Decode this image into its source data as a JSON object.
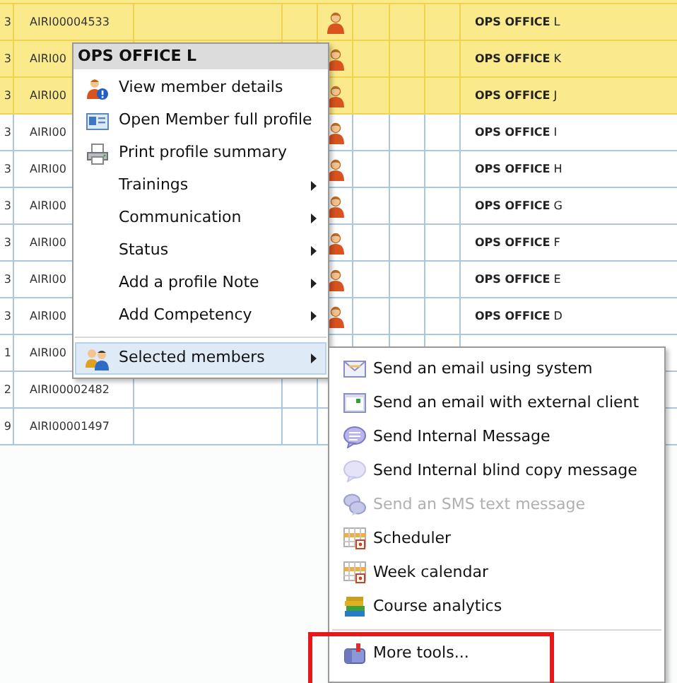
{
  "table": {
    "rows": [
      {
        "column_1": "3",
        "member_id": "AIRI00004533",
        "member_icon": true,
        "name": "**OPS OFFICE** L",
        "selected": true
      },
      {
        "column_1": "3",
        "member_id": "AIRI00",
        "member_icon": true,
        "name": "**OPS OFFICE** K",
        "selected": true
      },
      {
        "column_1": "3",
        "member_id": "AIRI00",
        "member_icon": true,
        "name": "**OPS OFFICE** J",
        "selected": true
      },
      {
        "column_1": "3",
        "member_id": "AIRI00",
        "member_icon": true,
        "name": "**OPS OFFICE** I",
        "selected": false
      },
      {
        "column_1": "3",
        "member_id": "AIRI00",
        "member_icon": true,
        "name": "**OPS OFFICE** H",
        "selected": false
      },
      {
        "column_1": "3",
        "member_id": "AIRI00",
        "member_icon": true,
        "name": "**OPS OFFICE** G",
        "selected": false
      },
      {
        "column_1": "3",
        "member_id": "AIRI00",
        "member_icon": true,
        "name": "**OPS OFFICE** F",
        "selected": false
      },
      {
        "column_1": "3",
        "member_id": "AIRI00",
        "member_icon": true,
        "name": "**OPS OFFICE** E",
        "selected": false
      },
      {
        "column_1": "3",
        "member_id": "AIRI00",
        "member_icon": true,
        "name": "**OPS OFFICE** D",
        "selected": false
      },
      {
        "column_1": "1",
        "member_id": "AIRI00",
        "member_icon": false,
        "selected": false
      },
      {
        "column_1": "2",
        "member_id": "AIRI00002482",
        "member_icon": false,
        "selected": false
      },
      {
        "column_1": "9",
        "member_id": "AIRI00001497",
        "member_icon": false,
        "selected": false
      }
    ]
  },
  "context_menu": {
    "title": "OPS OFFICE L",
    "items": [
      {
        "label": "View member details",
        "kind": "member-info",
        "has_submenu": false,
        "selected": false
      },
      {
        "label": "Open Member full profile",
        "kind": "profile-card",
        "has_submenu": false,
        "selected": false
      },
      {
        "label": "Print profile summary",
        "kind": "printer",
        "has_submenu": false,
        "selected": false
      },
      {
        "label": "Trainings",
        "has_submenu": true,
        "selected": false
      },
      {
        "label": "Communication",
        "has_submenu": true,
        "selected": false
      },
      {
        "label": "Status",
        "has_submenu": true,
        "selected": false
      },
      {
        "label": "Add a profile Note",
        "has_submenu": true,
        "selected": false
      },
      {
        "label": "Add Competency",
        "has_submenu": true,
        "selected": false
      },
      {
        "label": "Selected members",
        "kind": "people",
        "has_submenu": true,
        "selected": true,
        "separator_before": true
      }
    ]
  },
  "submenu": {
    "items": [
      {
        "label": "Send an email using system",
        "kind": "envelope",
        "disabled": false
      },
      {
        "label": "Send an email with external client",
        "kind": "window",
        "disabled": false
      },
      {
        "label": "Send Internal Message",
        "kind": "speech",
        "disabled": false
      },
      {
        "label": "Send Internal blind copy message",
        "kind": "speech-light",
        "disabled": false
      },
      {
        "label": "Send an SMS text message",
        "kind": "speech-double",
        "disabled": true
      },
      {
        "label": "Scheduler",
        "kind": "calendar",
        "disabled": false
      },
      {
        "label": "Week calendar",
        "kind": "calendar",
        "disabled": false
      },
      {
        "label": "Course analytics",
        "kind": "books",
        "disabled": false
      },
      {
        "label": "More tools...",
        "kind": "toolbox",
        "disabled": false,
        "separator_before": true,
        "highlighted": true
      }
    ]
  }
}
